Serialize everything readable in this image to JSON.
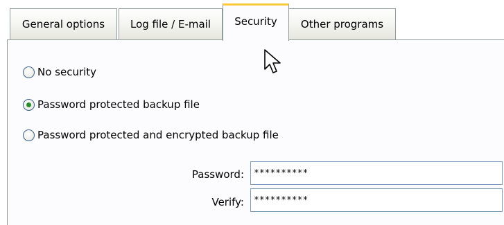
{
  "tabs": [
    {
      "label": "General options",
      "selected": false
    },
    {
      "label": "Log file / E-mail",
      "selected": false
    },
    {
      "label": "Security",
      "selected": true
    },
    {
      "label": "Other programs",
      "selected": false
    }
  ],
  "security": {
    "options": [
      {
        "label": "No security",
        "checked": false
      },
      {
        "label": "Password protected backup file",
        "checked": true
      },
      {
        "label": "Password protected and encrypted backup file",
        "checked": false
      }
    ],
    "password_label": "Password:",
    "password_value": "**********",
    "verify_label": "Verify:",
    "verify_value": "**********"
  },
  "colors": {
    "selected_tab_accent": "#ffc83c",
    "radio_dot": "#2b8a2b",
    "border": "#919b9c"
  },
  "icons": {
    "cursor": "arrow-cursor-icon"
  }
}
